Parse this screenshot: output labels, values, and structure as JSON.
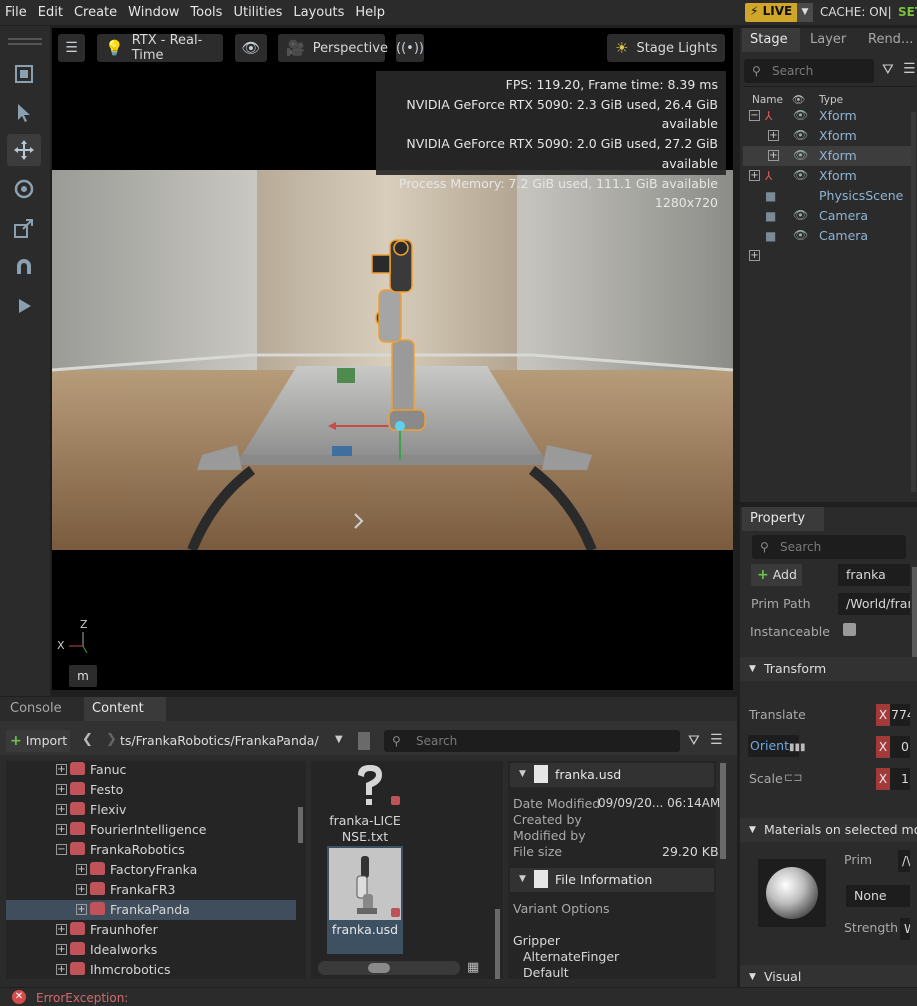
{
  "menubar": {
    "items": [
      "File",
      "Edit",
      "Create",
      "Window",
      "Tools",
      "Utilities",
      "Layouts",
      "Help"
    ],
    "live_label": "LIVE",
    "cache_label": "CACHE: ON|",
    "set_label": "SET"
  },
  "viewport": {
    "render_mode": "RTX - Real-Time",
    "camera": "Perspective",
    "lights": "Stage Lights",
    "stats": [
      "FPS: 119.20, Frame time: 8.39 ms",
      "NVIDIA GeForce RTX 5090: 2.3 GiB used, 26.4 GiB available",
      "NVIDIA GeForce RTX 5090: 2.0 GiB used, 27.2 GiB available",
      "Process Memory: 7.2 GiB used, 111.1 GiB available",
      "1280x720"
    ],
    "axis_z": "Z",
    "axis_x": "X",
    "m_label": "m"
  },
  "stage": {
    "tabs": [
      "Stage",
      "Layer",
      "Rend..."
    ],
    "search_placeholder": "Search",
    "col_name": "Name",
    "col_type": "Type",
    "rows": [
      {
        "label": "Xform",
        "exp": "−",
        "eye": true
      },
      {
        "label": "Xform",
        "exp": "+",
        "eye": true
      },
      {
        "label": "Xform",
        "exp": "+",
        "eye": true
      },
      {
        "label": "Xform",
        "exp": "+",
        "eye": true
      },
      {
        "label": "PhysicsScene",
        "exp": "",
        "eye": false
      },
      {
        "label": "Camera",
        "exp": "",
        "eye": true
      },
      {
        "label": "Camera",
        "exp": "",
        "eye": true
      },
      {
        "label": "",
        "exp": "+",
        "eye": false
      }
    ]
  },
  "property": {
    "tab": "Property",
    "search_placeholder": "Search",
    "add_label": "Add",
    "name_value": "franka",
    "prim_path_label": "Prim Path",
    "prim_path_value": "/World/fran",
    "instanceable_label": "Instanceable",
    "transform_label": "Transform",
    "translate_label": "Translate",
    "translate_value": "774",
    "orient_label": "Orient",
    "orient_value": "0.",
    "scale_label": "Scale",
    "scale_value": "1.",
    "x_label": "X",
    "materials_label": "Materials on selected mod",
    "prim_label": "Prim",
    "prim_value": "/\\",
    "none_label": "None",
    "strength_label": "Strength",
    "strength_value": "W",
    "visual_label": "Visual"
  },
  "content": {
    "tabs": [
      "Console",
      "Content"
    ],
    "import_label": "Import",
    "path": "ts/FrankaRobotics/FrankaPanda/",
    "search_placeholder": "Search",
    "tree": [
      {
        "label": "Fanuc",
        "exp": "+",
        "indent": 0
      },
      {
        "label": "Festo",
        "exp": "+",
        "indent": 0
      },
      {
        "label": "Flexiv",
        "exp": "+",
        "indent": 0
      },
      {
        "label": "FourierIntelligence",
        "exp": "+",
        "indent": 0
      },
      {
        "label": "FrankaRobotics",
        "exp": "−",
        "indent": 0
      },
      {
        "label": "FactoryFranka",
        "exp": "+",
        "indent": 1
      },
      {
        "label": "FrankaFR3",
        "exp": "+",
        "indent": 1
      },
      {
        "label": "FrankaPanda",
        "exp": "+",
        "indent": 1
      },
      {
        "label": "Fraunhofer",
        "exp": "+",
        "indent": 0
      },
      {
        "label": "Idealworks",
        "exp": "+",
        "indent": 0
      },
      {
        "label": "Ihmcrobotics",
        "exp": "+",
        "indent": 0
      }
    ],
    "file1_label": "franka-LICE NSE.txt",
    "file2_label": "franka.usd",
    "info_title": "franka.usd",
    "date_modified_label": "Date Modified",
    "date_modified_value": "09/09/20... 06:14AM",
    "created_by_label": "Created by",
    "modified_by_label": "Modified by",
    "file_size_label": "File size",
    "file_size_value": "29.20 KB",
    "file_info_label": "File Information",
    "variant_label": "Variant Options",
    "gripper_label": "Gripper",
    "gripper_opt1": "AlternateFinger",
    "gripper_opt2": "Default"
  },
  "status": {
    "error_text": "ErrorException:"
  }
}
